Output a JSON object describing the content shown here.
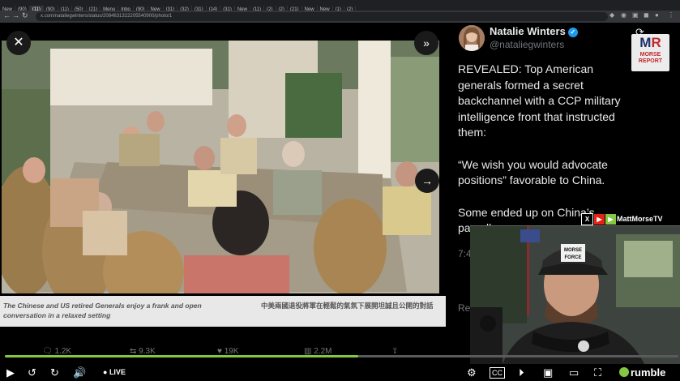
{
  "browser": {
    "tabs": [
      "New",
      "(90)",
      "(11)",
      "(90)",
      "(11)",
      "(50)",
      "(21)",
      "Menu",
      "Inbo",
      "(90)",
      "New",
      "(31)",
      "(32)",
      "(31)",
      "(14)",
      "(31)",
      "New",
      "(11)",
      "(2)",
      "(2)",
      "(21)",
      "New",
      "New",
      "(1)",
      "(2)"
    ],
    "active_tab": "(11)",
    "url": "x.com/nataliegwinters/status/2084631322205540900/photo/1"
  },
  "post": {
    "author_name": "Natalie Winters",
    "author_handle": "@nataliegwinters",
    "text_paragraphs": [
      "REVEALED: Top American generals formed a secret backchannel with a CCP military intelligence front that instructed them:",
      "“We wish you would advocate positions” favorable to China.",
      "Some ended up on China’s payroll."
    ],
    "caption_en": "The Chinese and US retired Generals enjoy a frank and open conversation in a relaxed setting",
    "caption_zh": "中美兩國退役將軍在輕鬆的氣氛下展開坦誠且公開的對話",
    "actions": {
      "replies": "1.2K",
      "reposts": "9.3K",
      "likes": "19K",
      "views": "2.2M"
    },
    "partial_time": "7:4",
    "partial_repost": "Re"
  },
  "overlay": {
    "logo_main_m": "M",
    "logo_main_r": "R",
    "logo_sub1": "MORSE",
    "logo_sub2": "REPORT",
    "social_handle": "MattMorseTV",
    "cap_text1": "MORSE",
    "cap_text2": "FORCE"
  },
  "player": {
    "live_label": "LIVE",
    "brand": "rumble",
    "progress": 0.525,
    "accent": "#85c742"
  }
}
